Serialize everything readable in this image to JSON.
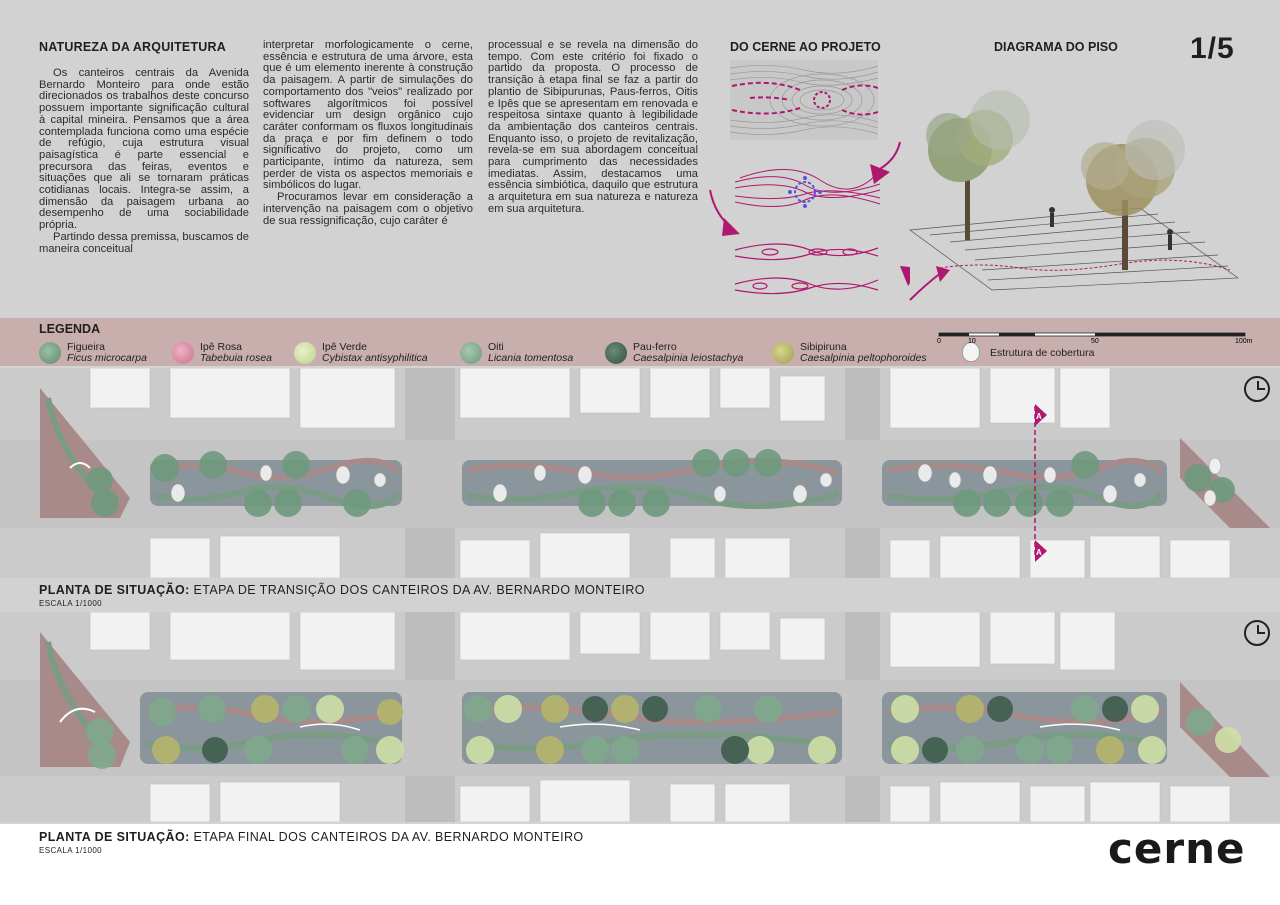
{
  "page_number": "1/5",
  "natureza": {
    "title": "NATUREZA DA ARQUITETURA",
    "col1": [
      "Os canteiros centrais da Avenida Bernardo Monteiro para onde estão direcionados os trabalhos deste concurso possuem importante significação cultural à capital mineira. Pensamos que a área contemplada funciona como uma espécie de refúgio, cuja estrutura visual paisagística é parte essencial e precursora das feiras, eventos e situações que ali se tornaram práticas cotidianas locais. Integra-se assim, a dimensão da paisagem urbana ao desempenho de uma sociabilidade própria.",
      "Partindo dessa premissa, buscamos de maneira conceitual"
    ],
    "col2": [
      "interpretar morfologicamente o cerne, essência e estrutura de uma árvore, esta que é um elemento inerente à construção da paisagem. A partir de simulações do comportamento dos \"veios\" realizado por softwares algorítmicos foi possível evidenciar um design orgânico cujo caráter conformam os fluxos longitudinais da praça e por fim definem o todo significativo do projeto, como um participante, íntimo da natureza, sem perder de vista os aspectos memoriais e simbólicos do lugar.",
      "Procuramos levar em consideração a intervenção na paisagem com o objetivo de sua ressignificação, cujo caráter é"
    ],
    "col3": [
      "processual e se revela na dimensão do tempo. Com este critério foi fixado o partido da proposta. O processo de transição à etapa final se faz a partir do plantio de Sibipurunas, Paus-ferros, Oitis e Ipês que se apresentam em renovada e respeitosa sintaxe quanto à legibilidade da ambientação dos canteiros centrais. Enquanto isso, o projeto de revitalização, revela-se em sua abordagem conceitual para cumprimento das necessidades imediatas. Assim, destacamos uma essência simbiótica, daquilo que estrutura a arquitetura em sua natureza e natureza em sua arquitetura."
    ]
  },
  "diagrams": {
    "cerne_title": "DO CERNE AO PROJETO",
    "piso_title": "DIAGRAMA DO PISO"
  },
  "legend": {
    "title": "LEGENDA",
    "items": [
      {
        "name": "Figueira",
        "sci": "Ficus microcarpa",
        "color": "#6f9a7e"
      },
      {
        "name": "Ipê Rosa",
        "sci": "Tabebuia rosea",
        "color": "#d98ba3"
      },
      {
        "name": "Ipê Verde",
        "sci": "Cybistax antisyphilitica",
        "color": "#cfe0a6"
      },
      {
        "name": "Oiti",
        "sci": "Licania tomentosa",
        "color": "#7fa98d"
      },
      {
        "name": "Pau-ferro",
        "sci": "Caesalpinia leiostachya",
        "color": "#3f5d4d"
      },
      {
        "name": "Sibipiruna",
        "sci": "Caesalpinia peltophoroides",
        "color": "#b6b56c"
      }
    ],
    "cover": "Estrutura de cobertura",
    "scale_ticks": [
      "0",
      "10",
      "50",
      "100m"
    ]
  },
  "plan1": {
    "title_bold": "PLANTA DE SITUAÇÃO:",
    "title_rest": "ETAPA DE TRANSIÇÃO DOS CANTEIROS DA AV. BERNARDO MONTEIRO",
    "scale": "ESCALA 1/1000",
    "section_mark": "A"
  },
  "plan2": {
    "title_bold": "PLANTA DE SITUAÇÃO:",
    "title_rest": "ETAPA FINAL DOS CANTEIROS DA AV. BERNARDO MONTEIRO",
    "scale": "ESCALA 1/1000"
  },
  "brand": "cerne",
  "colors": {
    "accent": "#b0186e",
    "legend_band": "#c9aeae",
    "plaza_pink": "#a88a8a",
    "plaza_green": "#7a9c84",
    "plaza_grey": "#8b959c"
  }
}
